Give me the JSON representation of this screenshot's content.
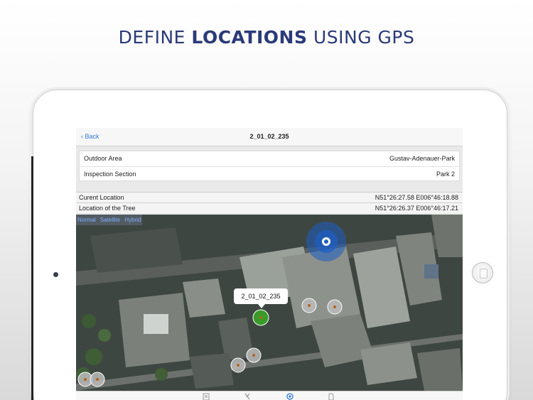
{
  "headline": {
    "part1": "DEFINE ",
    "bold": "LOCATIONS",
    "part2": " USING GPS"
  },
  "nav": {
    "back_label": "Back",
    "title": "2_01_02_235"
  },
  "info": [
    {
      "label": "Outdoor Area",
      "value": "Gustav-Adenauer-Park"
    },
    {
      "label": "Inspection Section",
      "value": "Park 2"
    }
  ],
  "locations": {
    "current_label": "Curent Location",
    "current_value": "N51°26:27.58 E006°46:18.88",
    "tree_label": "Location of the Tree",
    "tree_value": "N51°26:26.37 E006°46:17.21"
  },
  "map": {
    "types": [
      "Normal",
      "Satellite",
      "Hybrid"
    ],
    "callout": "2_01_02_235"
  },
  "tabs": [
    "list-icon",
    "tools-icon",
    "location-icon",
    "document-icon"
  ],
  "colors": {
    "headline": "#2b3a78",
    "accent": "#2f7ad8",
    "selected_tree": "#3a9a2a",
    "gps": "#1e5fc4"
  }
}
